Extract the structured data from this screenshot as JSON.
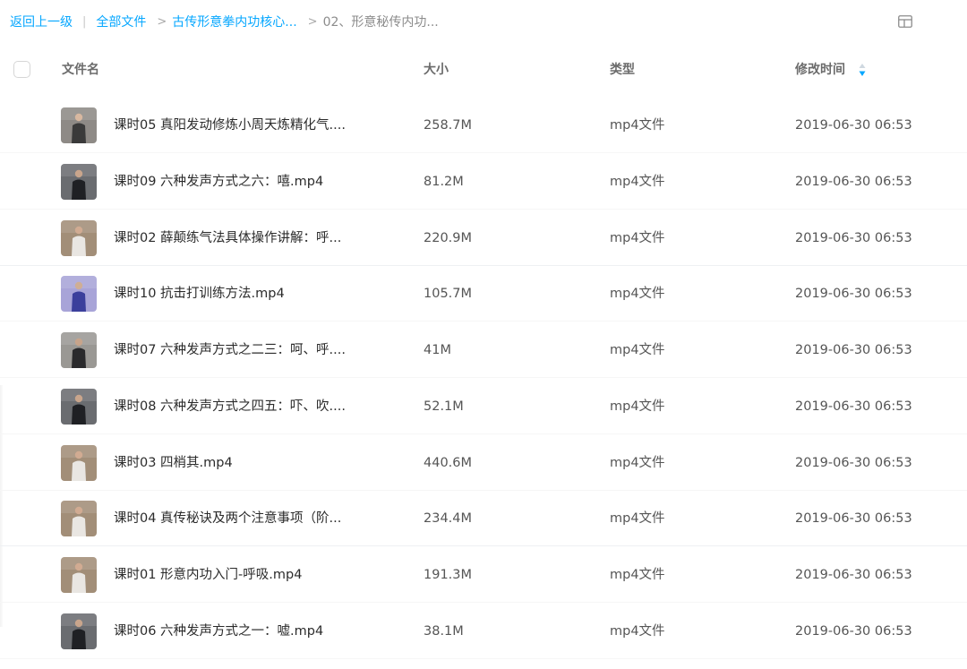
{
  "breadcrumb": {
    "back": "返回上一级",
    "all_files": "全部文件",
    "folder1": "古传形意拳内功核心...",
    "current": "02、形意秘传内功..."
  },
  "header": {
    "name": "文件名",
    "size": "大小",
    "type": "类型",
    "modified": "修改时间"
  },
  "icons": {
    "view_toggle": "grid-view-icon",
    "sort": "sort-descending-icon",
    "file_thumbnail": "video-thumbnail-icon"
  },
  "colors": {
    "link": "#06a7ff",
    "sort_accent": "#06a7ff"
  },
  "files": [
    {
      "name": "课时05 真阳发动修炼小周天炼精化气....",
      "size": "258.7M",
      "type": "mp4文件",
      "modified": "2019-06-30 06:53",
      "thumb": "grey-bg"
    },
    {
      "name": "课时09 六种发声方式之六：嘻.mp4",
      "size": "81.2M",
      "type": "mp4文件",
      "modified": "2019-06-30 06:53",
      "thumb": "dark-figure"
    },
    {
      "name": "课时02 薛颠练气法具体操作讲解：呼...",
      "size": "220.9M",
      "type": "mp4文件",
      "modified": "2019-06-30 06:53",
      "thumb": "stone-bg"
    },
    {
      "name": "课时10 抗击打训练方法.mp4",
      "size": "105.7M",
      "type": "mp4文件",
      "modified": "2019-06-30 06:53",
      "thumb": "purple-bg"
    },
    {
      "name": "课时07 六种发声方式之二三：呵、呼....",
      "size": "41M",
      "type": "mp4文件",
      "modified": "2019-06-30 06:53",
      "thumb": "grey-figure"
    },
    {
      "name": "课时08 六种发声方式之四五：吓、吹....",
      "size": "52.1M",
      "type": "mp4文件",
      "modified": "2019-06-30 06:53",
      "thumb": "dark-figure"
    },
    {
      "name": "课时03 四梢其.mp4",
      "size": "440.6M",
      "type": "mp4文件",
      "modified": "2019-06-30 06:53",
      "thumb": "stone-bg"
    },
    {
      "name": "课时04 真传秘诀及两个注意事项（阶...",
      "size": "234.4M",
      "type": "mp4文件",
      "modified": "2019-06-30 06:53",
      "thumb": "stone-bg"
    },
    {
      "name": "课时01 形意内功入门-呼吸.mp4",
      "size": "191.3M",
      "type": "mp4文件",
      "modified": "2019-06-30 06:53",
      "thumb": "stone-bg"
    },
    {
      "name": "课时06 六种发声方式之一：嘘.mp4",
      "size": "38.1M",
      "type": "mp4文件",
      "modified": "2019-06-30 06:53",
      "thumb": "dark-figure"
    }
  ]
}
